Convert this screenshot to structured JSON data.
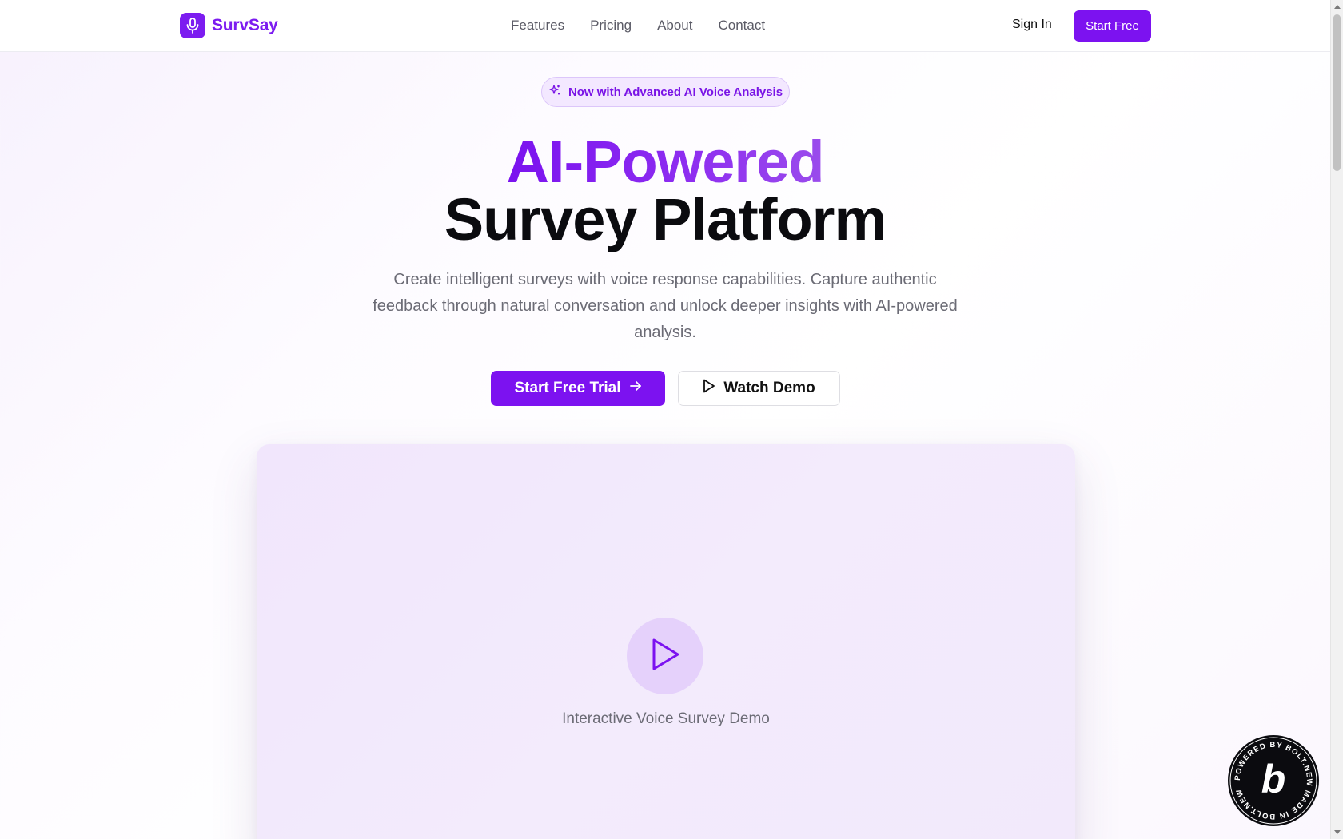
{
  "brand": {
    "name": "SurvSay",
    "accent": "#7c12f0",
    "logo_icon": "microphone-icon"
  },
  "nav": {
    "items": [
      {
        "label": "Features"
      },
      {
        "label": "Pricing"
      },
      {
        "label": "About"
      },
      {
        "label": "Contact"
      }
    ],
    "sign_in": "Sign In",
    "start_free": "Start Free"
  },
  "hero": {
    "pill_text": "Now with Advanced AI Voice Analysis",
    "pill_icon": "sparkles-icon",
    "title_line1": "AI-Powered",
    "title_line2": "Survey Platform",
    "subtitle": "Create intelligent surveys with voice response capabilities. Capture authentic feedback through natural conversation and unlock deeper insights with AI-powered analysis.",
    "primary_cta": "Start Free Trial",
    "secondary_cta": "Watch Demo"
  },
  "demo": {
    "caption": "Interactive Voice Survey Demo",
    "play_icon": "play-icon"
  },
  "badge": {
    "text": "POWERED BY BOLT.NEW MADE IN BOLT.NEW",
    "letter": "b"
  }
}
